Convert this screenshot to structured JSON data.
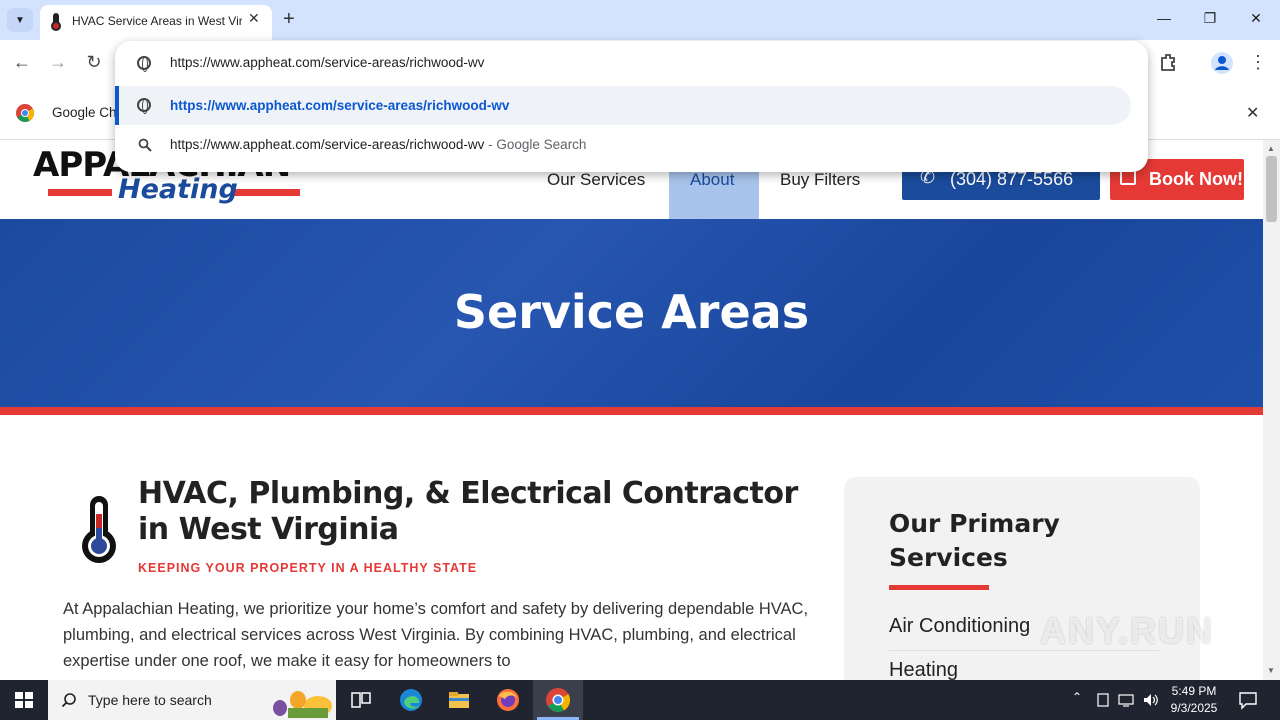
{
  "browser": {
    "tab_title": "HVAC Service Areas in West Virg",
    "address": "https://www.appheat.com/service-areas/richwood-wv",
    "suggestions": [
      {
        "text": "https://www.appheat.com/service-areas/richwood-wv",
        "suffix": ""
      },
      {
        "text": "https://www.appheat.com/service-areas/richwood-wv",
        "suffix": " - Google Search"
      }
    ],
    "infobar_text": "Google Ch",
    "controls": {
      "tab_close": "✕",
      "new_tab": "+",
      "minimize": "—",
      "restore": "❐",
      "close": "✕",
      "back": "←",
      "forward": "→",
      "reload": "↻",
      "menu": "⋮",
      "infobar_close": "✕"
    }
  },
  "site": {
    "logo_top": "APPALACHIAN",
    "logo_bottom": "Heating",
    "nav": [
      "Our Services",
      "About",
      "Buy Filters"
    ],
    "phone": "(304) 877-5566",
    "book": "Book Now!",
    "hero_title": "Service Areas",
    "main_heading": "HVAC, Plumbing, & Electrical Contractor in West Virginia",
    "tagline": "KEEPING YOUR PROPERTY IN A HEALTHY STATE",
    "body": "At Appalachian Heating, we prioritize your home’s comfort and safety by delivering dependable HVAC, plumbing, and electrical services across West Virginia. By combining HVAC, plumbing, and electrical expertise under one roof, we make it easy for homeowners to",
    "sidebar_title": "Our Primary Services",
    "services": [
      "Air Conditioning",
      "Heating"
    ],
    "colors": {
      "brand_blue": "#1a4b9c",
      "brand_red": "#e53935"
    }
  },
  "watermark": "ANY.RUN",
  "taskbar": {
    "search_placeholder": "Type here to search",
    "time": "5:49 PM",
    "date": "9/3/2025"
  },
  "icons": [
    "chrome-icon",
    "globe-icon",
    "search-icon",
    "phone-icon",
    "calendar-icon",
    "thermometer-icon",
    "windows-start-icon",
    "edge-icon",
    "file-explorer-icon",
    "firefox-icon",
    "task-view-icon",
    "extensions-icon",
    "profile-icon"
  ]
}
